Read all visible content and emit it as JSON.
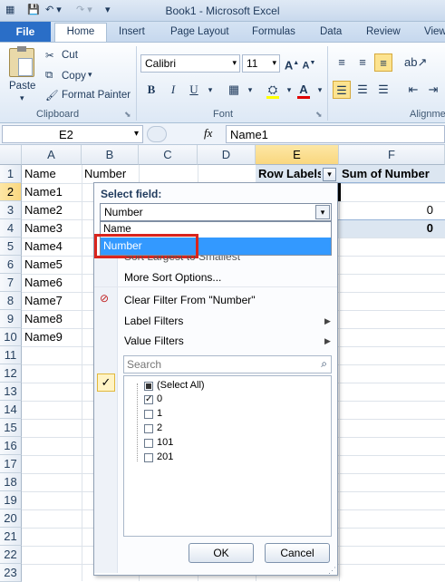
{
  "window": {
    "title": "Book1 - Microsoft Excel"
  },
  "tabs": [
    "File",
    "Home",
    "Insert",
    "Page Layout",
    "Formulas",
    "Data",
    "Review",
    "View"
  ],
  "clipboard": {
    "paste": "Paste",
    "cut": "Cut",
    "copy": "Copy",
    "format_painter": "Format Painter",
    "label": "Clipboard"
  },
  "font": {
    "name": "Calibri",
    "size": "11",
    "label": "Font"
  },
  "alignment": {
    "label": "Alignme"
  },
  "formula_bar": {
    "cell_ref": "E2",
    "fx": "fx",
    "value": "Name1"
  },
  "columns": [
    "A",
    "B",
    "C",
    "D",
    "E",
    "F"
  ],
  "rows": [
    "1",
    "2",
    "3",
    "4",
    "5",
    "6",
    "7",
    "8",
    "9",
    "10",
    "11",
    "12",
    "13",
    "14",
    "15",
    "16",
    "17",
    "18",
    "19",
    "20",
    "21",
    "22",
    "23"
  ],
  "cells": {
    "A": [
      "Name",
      "Name1",
      "Name2",
      "Name3",
      "Name4",
      "Name5",
      "Name6",
      "Name7",
      "Name8",
      "Name9"
    ],
    "B1": "Number",
    "E1": "Row Labels",
    "F1": "Sum of Number",
    "F3": "0",
    "F4": "0"
  },
  "dropdown": {
    "select_field_label": "Select field:",
    "selected_field": "Number",
    "field_options": [
      "Name",
      "Number"
    ],
    "sort_largest": "Sort Largest to Smallest",
    "more_sort": "More Sort Options...",
    "clear_filter": "Clear Filter From \"Number\"",
    "label_filters": "Label Filters",
    "value_filters": "Value Filters",
    "search_placeholder": "Search",
    "items": [
      {
        "label": "(Select All)",
        "state": "partial"
      },
      {
        "label": "0",
        "state": "checked"
      },
      {
        "label": "1",
        "state": "unchecked"
      },
      {
        "label": "2",
        "state": "unchecked"
      },
      {
        "label": "101",
        "state": "unchecked"
      },
      {
        "label": "201",
        "state": "unchecked"
      }
    ],
    "ok": "OK",
    "cancel": "Cancel"
  }
}
